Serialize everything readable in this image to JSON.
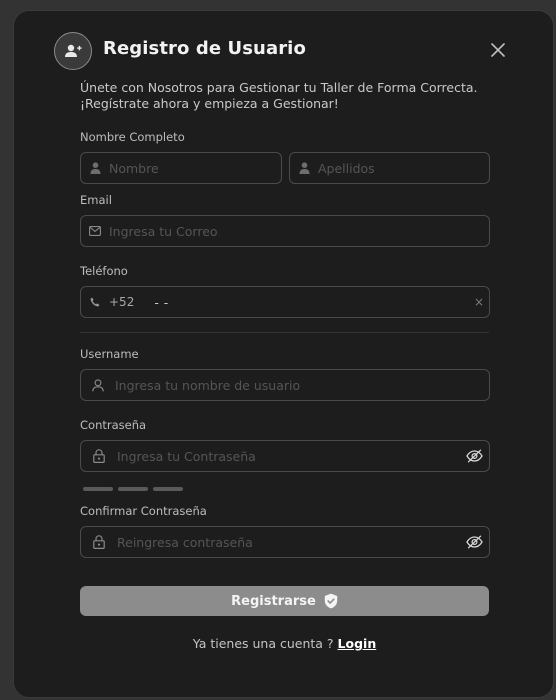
{
  "header": {
    "title": "Registro de Usuario",
    "intro": "Únete con Nosotros para Gestionar tu Taller de Forma Correcta. ¡Regístrate ahora y empieza a Gestionar!"
  },
  "form": {
    "full_name_label": "Nombre Completo",
    "first_name_placeholder": "Nombre",
    "last_name_placeholder": "Apellidos",
    "email_label": "Email",
    "email_placeholder": "Ingresa tu Correo",
    "phone_label": "Teléfono",
    "phone_prefix": "+52",
    "phone_mask": "-   -",
    "phone_clear": "×",
    "username_label": "Username",
    "username_placeholder": "Ingresa tu nombre de usuario",
    "password_label": "Contraseña",
    "password_placeholder": "Ingresa tu Contraseña",
    "confirm_password_label": "Confirmar Contraseña",
    "confirm_password_placeholder": "Reingresa contraseña",
    "submit_label": "Registrarse"
  },
  "footer": {
    "prompt": "Ya tienes una cuenta ?",
    "login_link": "Login"
  },
  "colors": {
    "background": "#333333",
    "modal": "#1d1d1d",
    "button": "#8c8c8c",
    "border": "#4a4a4a"
  },
  "icons": [
    "add-user-icon",
    "close-icon",
    "user-icon",
    "mail-icon",
    "phone-icon",
    "lock-icon",
    "eye-off-icon",
    "shield-check-icon"
  ]
}
